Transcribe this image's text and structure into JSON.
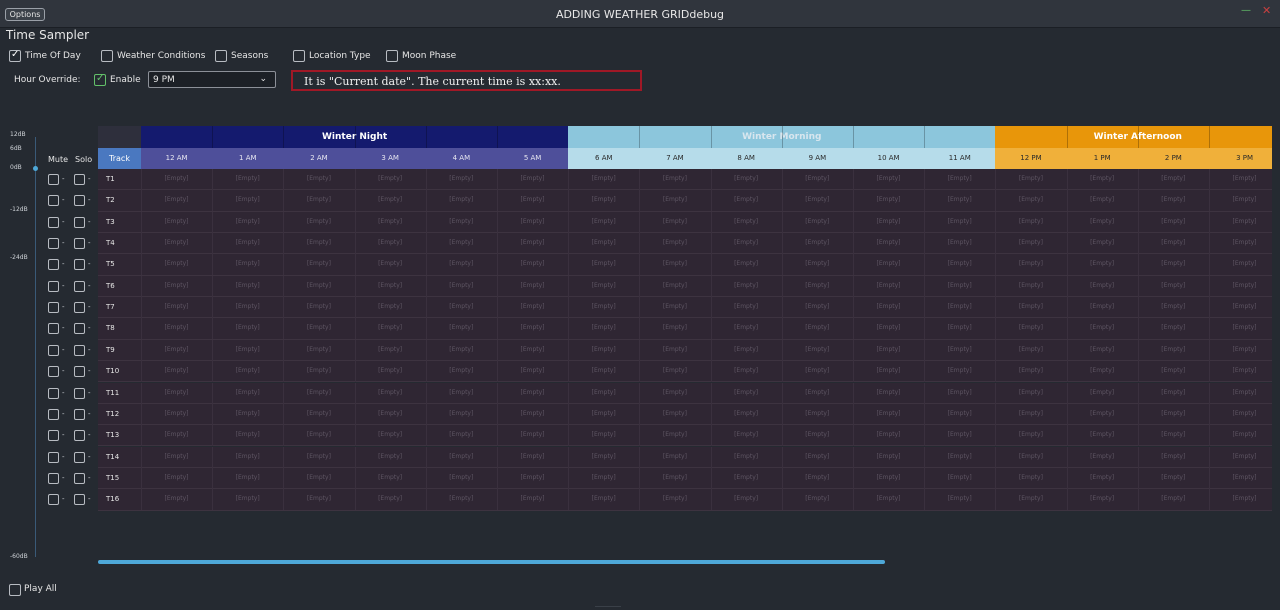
{
  "window": {
    "title": "ADDING WEATHER GRIDdebug",
    "options_label": "Options"
  },
  "app": {
    "title": "Time Sampler"
  },
  "filters": [
    {
      "label": "Time Of Day",
      "checked": true
    },
    {
      "label": "Weather Conditions",
      "checked": false
    },
    {
      "label": "Seasons",
      "checked": false
    },
    {
      "label": "Location Type",
      "checked": false
    },
    {
      "label": "Moon Phase",
      "checked": false
    }
  ],
  "hour_override": {
    "label": "Hour Override:",
    "enable_label": "Enable",
    "enabled": true,
    "selected": "9 PM"
  },
  "info_text": "It is \"Current date\". The current time is xx:xx.",
  "db_scale": [
    "12dB",
    "6dB",
    "0dB",
    "-12dB",
    "-24dB",
    "-60dB"
  ],
  "columns": {
    "mute": "Mute",
    "solo": "Solo",
    "track": "Track"
  },
  "groups": [
    {
      "name": "Winter Night",
      "color": "#141a6e",
      "text_color": "#ffffff",
      "span": 6
    },
    {
      "name": "Winter Morning",
      "color": "#8cc6dc",
      "text_color": "#d8e6ee",
      "span": 6
    },
    {
      "name": "Winter Afternoon",
      "color": "#e8960a",
      "text_color": "#ffffff",
      "span": 4
    }
  ],
  "hours": [
    {
      "label": "12 AM",
      "bg": "#4e4f9a"
    },
    {
      "label": "1 AM",
      "bg": "#4e4f9a"
    },
    {
      "label": "2 AM",
      "bg": "#4e4f9a"
    },
    {
      "label": "3 AM",
      "bg": "#4e4f9a"
    },
    {
      "label": "4 AM",
      "bg": "#4e4f9a"
    },
    {
      "label": "5 AM",
      "bg": "#4e4f9a"
    },
    {
      "label": "6 AM",
      "bg": "#b6dcea"
    },
    {
      "label": "7 AM",
      "bg": "#b6dcea"
    },
    {
      "label": "8 AM",
      "bg": "#b6dcea"
    },
    {
      "label": "9 AM",
      "bg": "#b6dcea"
    },
    {
      "label": "10 AM",
      "bg": "#b6dcea"
    },
    {
      "label": "11 AM",
      "bg": "#b6dcea"
    },
    {
      "label": "12 PM",
      "bg": "#f0b03a"
    },
    {
      "label": "1 PM",
      "bg": "#f0b03a"
    },
    {
      "label": "2 PM",
      "bg": "#f0b03a"
    },
    {
      "label": "3 PM",
      "bg": "#f0b03a"
    }
  ],
  "tracks": [
    "T1",
    "T2",
    "T3",
    "T4",
    "T5",
    "T6",
    "T7",
    "T8",
    "T9",
    "T10",
    "T11",
    "T12",
    "T13",
    "T14",
    "T15",
    "T16"
  ],
  "mute_dash": "-",
  "empty_label": "[Empty]",
  "play_all": {
    "label": "Play All",
    "checked": false
  },
  "colors": {
    "accent": "#4ea8d8",
    "highlight_border": "#a01826",
    "track_header": "#4a78c0"
  }
}
